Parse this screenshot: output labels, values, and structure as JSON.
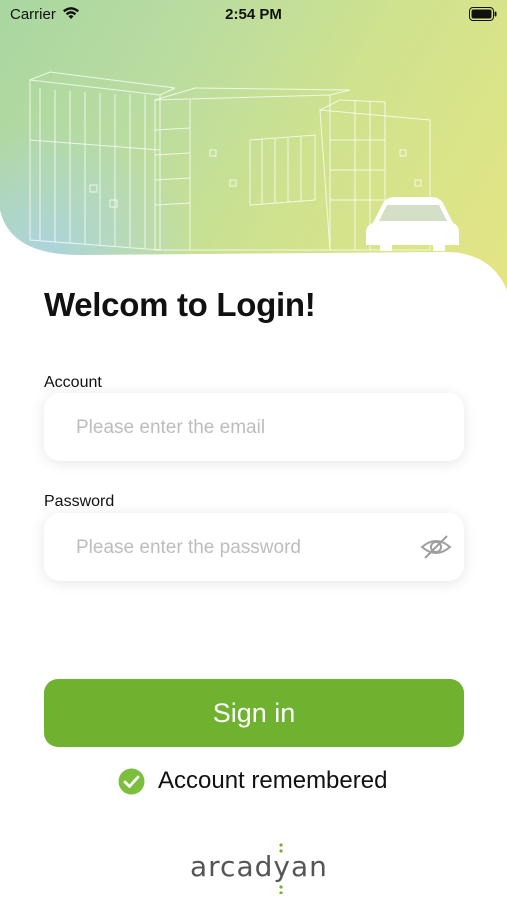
{
  "status_bar": {
    "carrier": "Carrier",
    "time": "2:54 PM"
  },
  "login": {
    "title": "Welcom to Login!",
    "account": {
      "label": "Account",
      "placeholder": "Please enter the email",
      "value": ""
    },
    "password": {
      "label": "Password",
      "placeholder": "Please enter the password",
      "value": "",
      "toggle_icon": "eye-slash-icon"
    },
    "sign_in_label": "Sign in",
    "remember": {
      "label": "Account remembered",
      "checked": true
    }
  },
  "brand": {
    "logo_text": "arcadyan"
  },
  "colors": {
    "accent": "#6fb22f",
    "check": "#7cbf3d",
    "placeholder": "#bdbdbd"
  }
}
